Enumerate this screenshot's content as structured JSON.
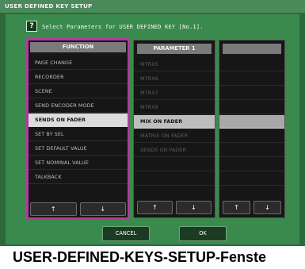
{
  "window": {
    "title": "USER DEFINED KEY SETUP"
  },
  "instruction": {
    "icon": "?",
    "text": "Select Parameters for USER DEFINED KEY [No.1]."
  },
  "function_list": {
    "header": "FUNCTION",
    "items": [
      "PAGE CHANGE",
      "RECORDER",
      "SCENE",
      "SEND ENCODER MODE",
      "SENDS ON FADER",
      "SET BY SEL",
      "SET DEFAULT VALUE",
      "SET NOMINAL VALUE",
      "TALKBACK"
    ],
    "selected_index": 4,
    "up_arrow": "↑",
    "down_arrow": "↓"
  },
  "parameter1_list": {
    "header": "PARAMETER 1",
    "items": [
      "MTRX5",
      "MTRX6",
      "MTRX7",
      "MTRX8",
      "MIX ON FADER",
      "MATRIX ON FADER",
      "SENDS ON FADER",
      "",
      ""
    ],
    "selected_index": 4,
    "up_arrow": "↑",
    "down_arrow": "↓"
  },
  "parameter2_list": {
    "header": "",
    "items": [
      "",
      "",
      "",
      "",
      "",
      "",
      "",
      "",
      ""
    ],
    "selected_index": 4,
    "up_arrow": "↑",
    "down_arrow": "↓"
  },
  "buttons": {
    "cancel": "CANCEL",
    "ok": "OK"
  },
  "caption": "USER-DEFINED-KEYS-SETUP-Fenste",
  "colors": {
    "window_bg": "#2c6a3c",
    "panel_bg": "#3b8a4d",
    "highlight_border": "#b03aa0",
    "selected_row": "#dcdcdc"
  }
}
